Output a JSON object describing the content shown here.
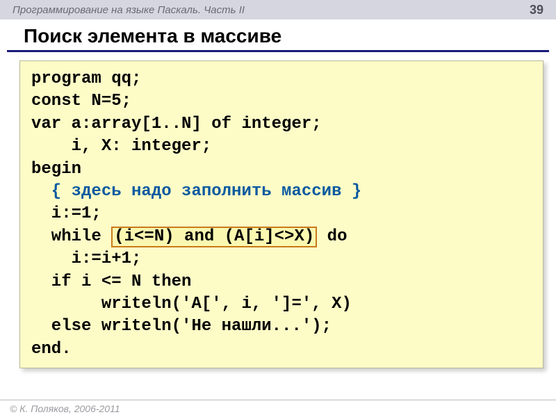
{
  "header": {
    "course_title": "Программирование на языке Паскаль. Часть II",
    "page_number": "39"
  },
  "slide": {
    "title": "Поиск элемента в массиве"
  },
  "code": {
    "l1": "program qq;",
    "l2": "const N=5;",
    "l3": "var a:array[1..N] of integer;",
    "l4": "    i, X: integer;",
    "l5": "begin",
    "l6_comment": "  { здесь надо заполнить массив }",
    "l7": "  i:=1;",
    "l8a": "  while ",
    "l8_box": "(i<=N) and (A[i]<>X)",
    "l8b": " do",
    "l9": "    i:=i+1;",
    "l10": "  if i <= N then",
    "l11": "       writeln('A[', i, ']=', X)",
    "l12": "  else writeln('Не нашли...');",
    "l13": "end."
  },
  "footer": {
    "copyright": "© К. Поляков, 2006-2011"
  }
}
